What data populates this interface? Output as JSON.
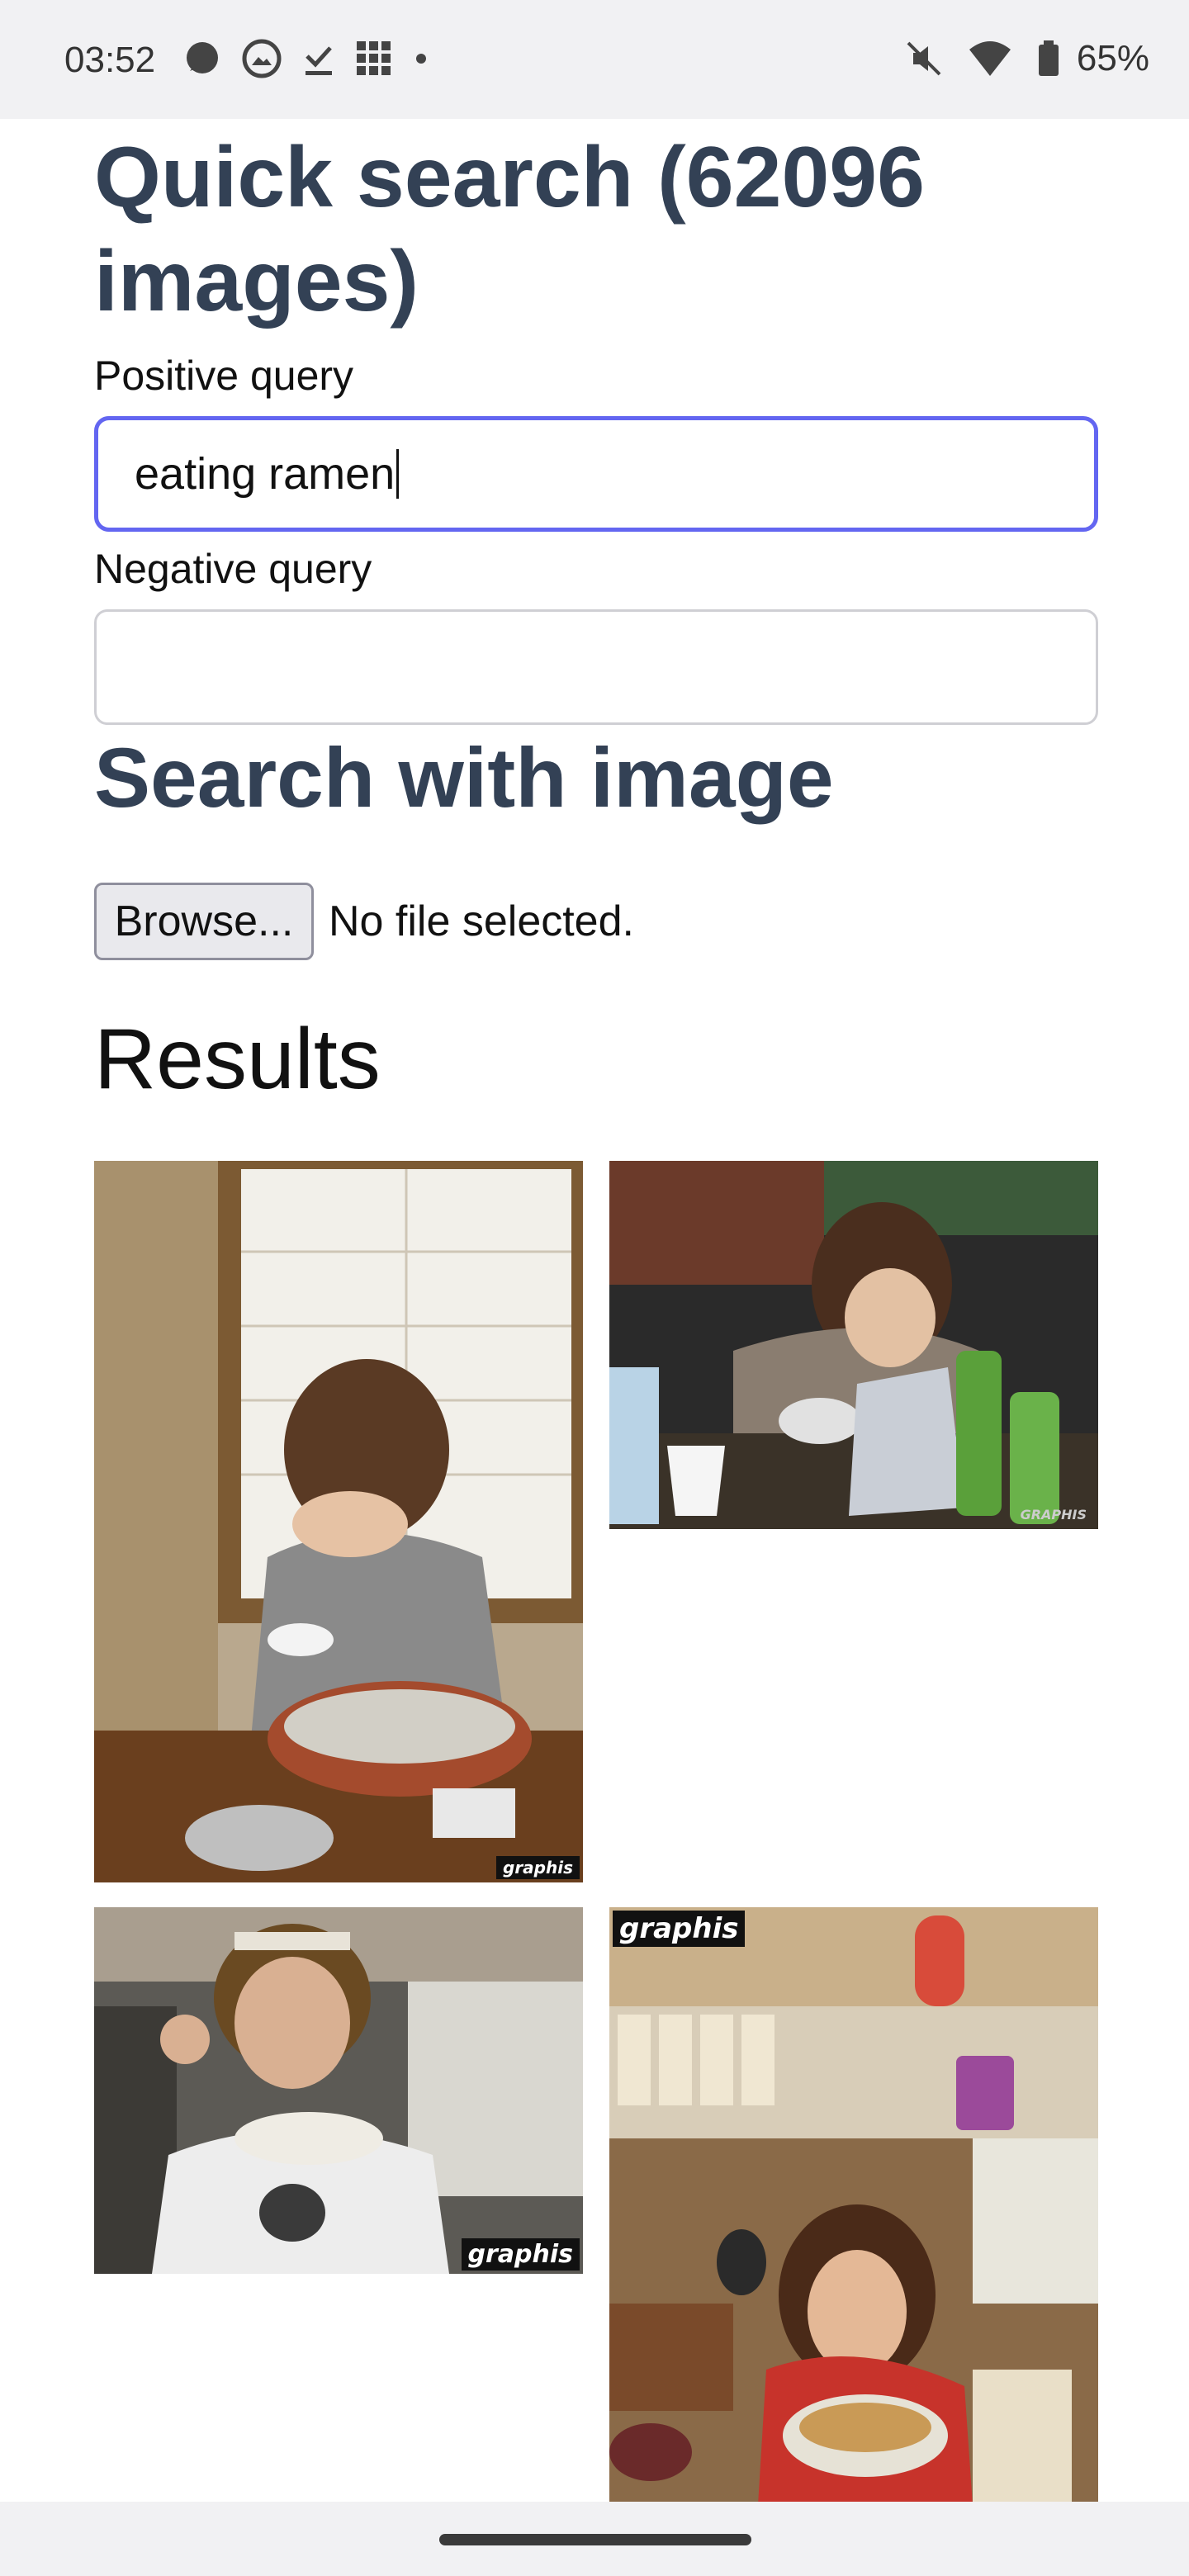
{
  "status_bar": {
    "time": "03:52",
    "battery": "65%",
    "left_icons": [
      "chat-bubble-icon",
      "gallery-icon",
      "download-done-icon",
      "app-grid-icon",
      "dot-icon"
    ],
    "right_icons": [
      "mute-icon",
      "wifi-icon",
      "battery-icon"
    ]
  },
  "page": {
    "title": "Quick search (62096 images)",
    "positive_label": "Positive query",
    "positive_value": "eating ramen",
    "negative_label": "Negative query",
    "negative_value": "",
    "image_search_heading": "Search with image",
    "browse_label": "Browse...",
    "file_status": "No file selected.",
    "results_heading": "Results"
  },
  "results": [
    {
      "description": "woman eating soba at a table by a window",
      "watermark": "graphis"
    },
    {
      "description": "woman eating from a bowl with bottles on table",
      "watermark": "GRAPHIS"
    },
    {
      "description": "woman eating from a bowl with a spoon",
      "watermark": "graphis"
    },
    {
      "description": "woman eating ramen in a busy restaurant",
      "watermark": "graphis"
    }
  ],
  "colors": {
    "heading": "#334155",
    "focus_border": "#6366f1",
    "status_bar_bg": "#f1f1f3"
  }
}
